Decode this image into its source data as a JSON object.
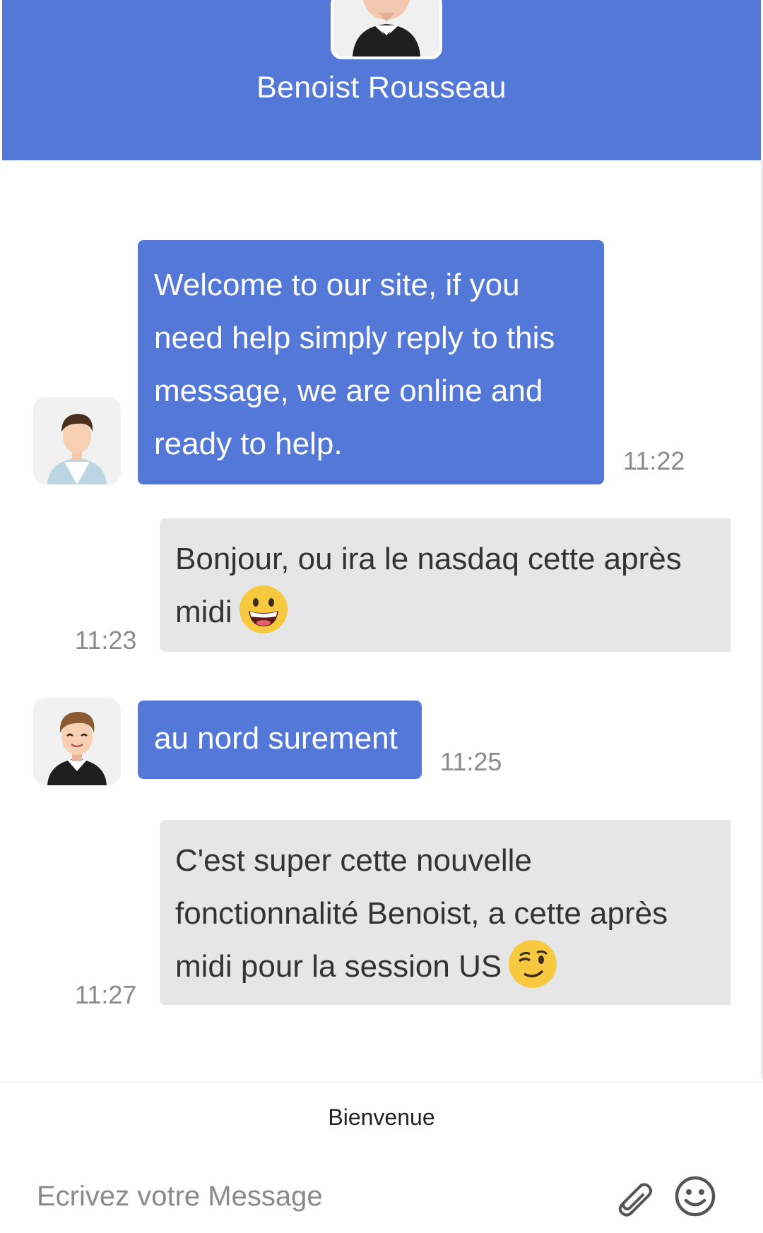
{
  "header": {
    "title": "Benoist Rousseau"
  },
  "messages": [
    {
      "direction": "out",
      "text": "Welcome to our site, if you need help simply reply to this message, we are online and ready to help.",
      "time": "11:22"
    },
    {
      "direction": "in",
      "text": "Bonjour, ou ira le nasdaq cette après midi",
      "emoji": "grinning-face",
      "time": "11:23"
    },
    {
      "direction": "out",
      "text": "au nord surement",
      "time": "11:25"
    },
    {
      "direction": "in",
      "text": "C'est super cette nouvelle fonctionnalité Benoist, a cette après midi pour la session US",
      "emoji": "winking-face",
      "time": "11:27"
    }
  ],
  "composer": {
    "banner": "Bienvenue",
    "placeholder": "Ecrivez votre Message",
    "attach_icon": "paperclip-icon",
    "emoji_icon": "smiley-icon"
  },
  "colors": {
    "accent": "#5478d8",
    "incoming_bubble": "#e6e6e6",
    "timestamp": "#8a8a8a"
  }
}
